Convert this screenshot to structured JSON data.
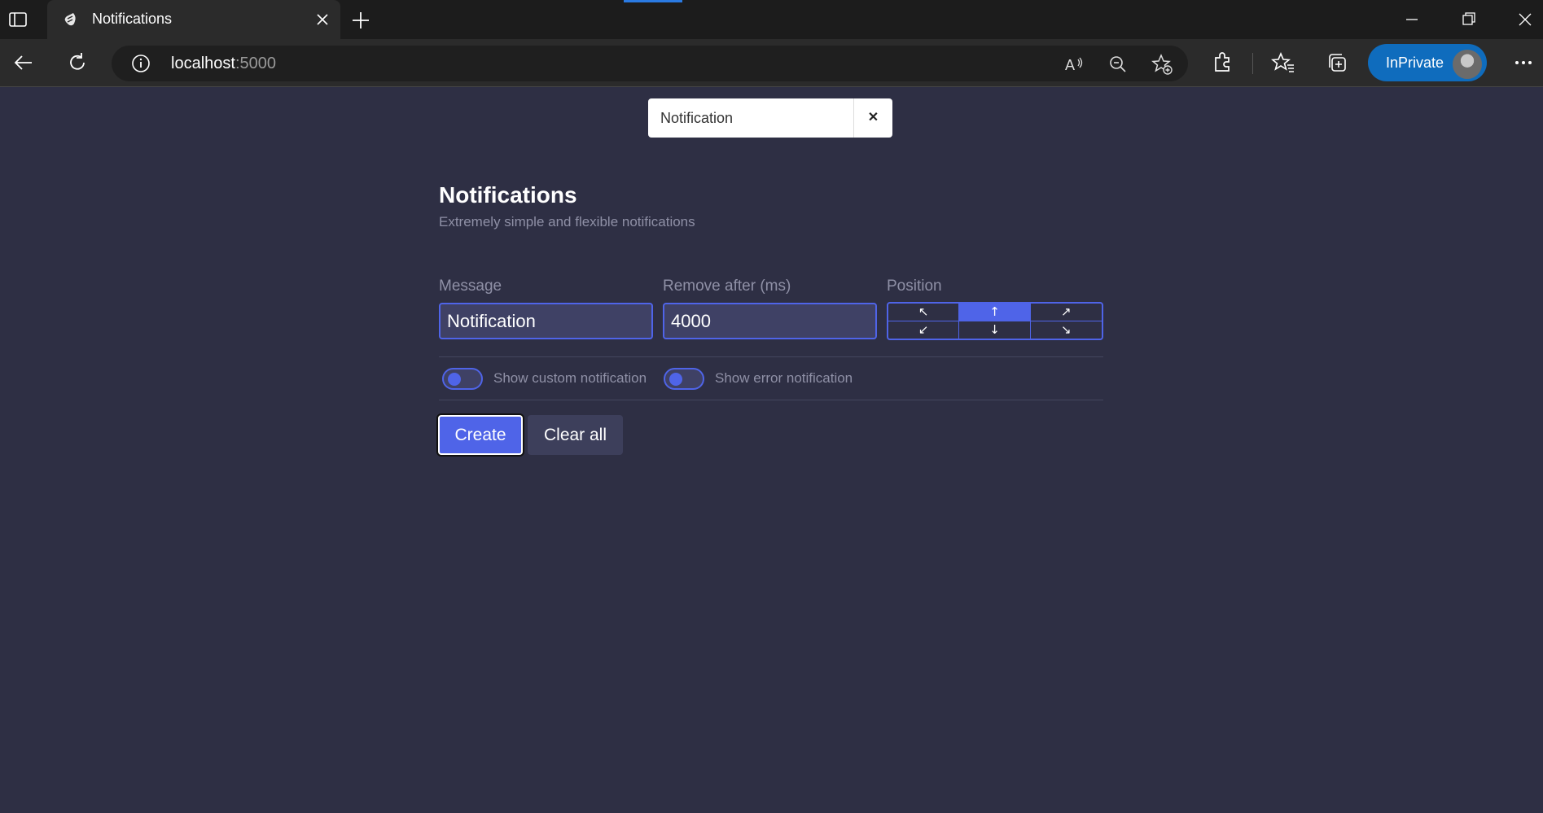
{
  "browser": {
    "tab_title": "Notifications",
    "address_host": "localhost",
    "address_port": ":5000",
    "profile_label": "InPrivate",
    "accent_color": "#0f6cbd"
  },
  "toast": {
    "message": "Notification",
    "close_label": "✕"
  },
  "header": {
    "title": "Notifications",
    "subtitle": "Extremely simple and flexible notifications"
  },
  "form": {
    "message_label": "Message",
    "message_value": "Notification",
    "remove_after_label": "Remove after (ms)",
    "remove_after_value": "4000",
    "position_label": "Position",
    "positions": [
      {
        "glyph": "↖",
        "value": "top-left"
      },
      {
        "glyph": "↑",
        "value": "top-center"
      },
      {
        "glyph": "↗",
        "value": "top-right"
      },
      {
        "glyph": "↙",
        "value": "bottom-left"
      },
      {
        "glyph": "↓",
        "value": "bottom-center"
      },
      {
        "glyph": "↘",
        "value": "bottom-right"
      }
    ],
    "selected_position": "top-center",
    "toggles": [
      {
        "label": "Show custom notification",
        "on": false
      },
      {
        "label": "Show error notification",
        "on": false
      }
    ]
  },
  "actions": {
    "create_label": "Create",
    "clear_label": "Clear all"
  },
  "colors": {
    "background": "#2e2f44",
    "primary": "#4f64e8",
    "muted_text": "#8f90a6"
  }
}
